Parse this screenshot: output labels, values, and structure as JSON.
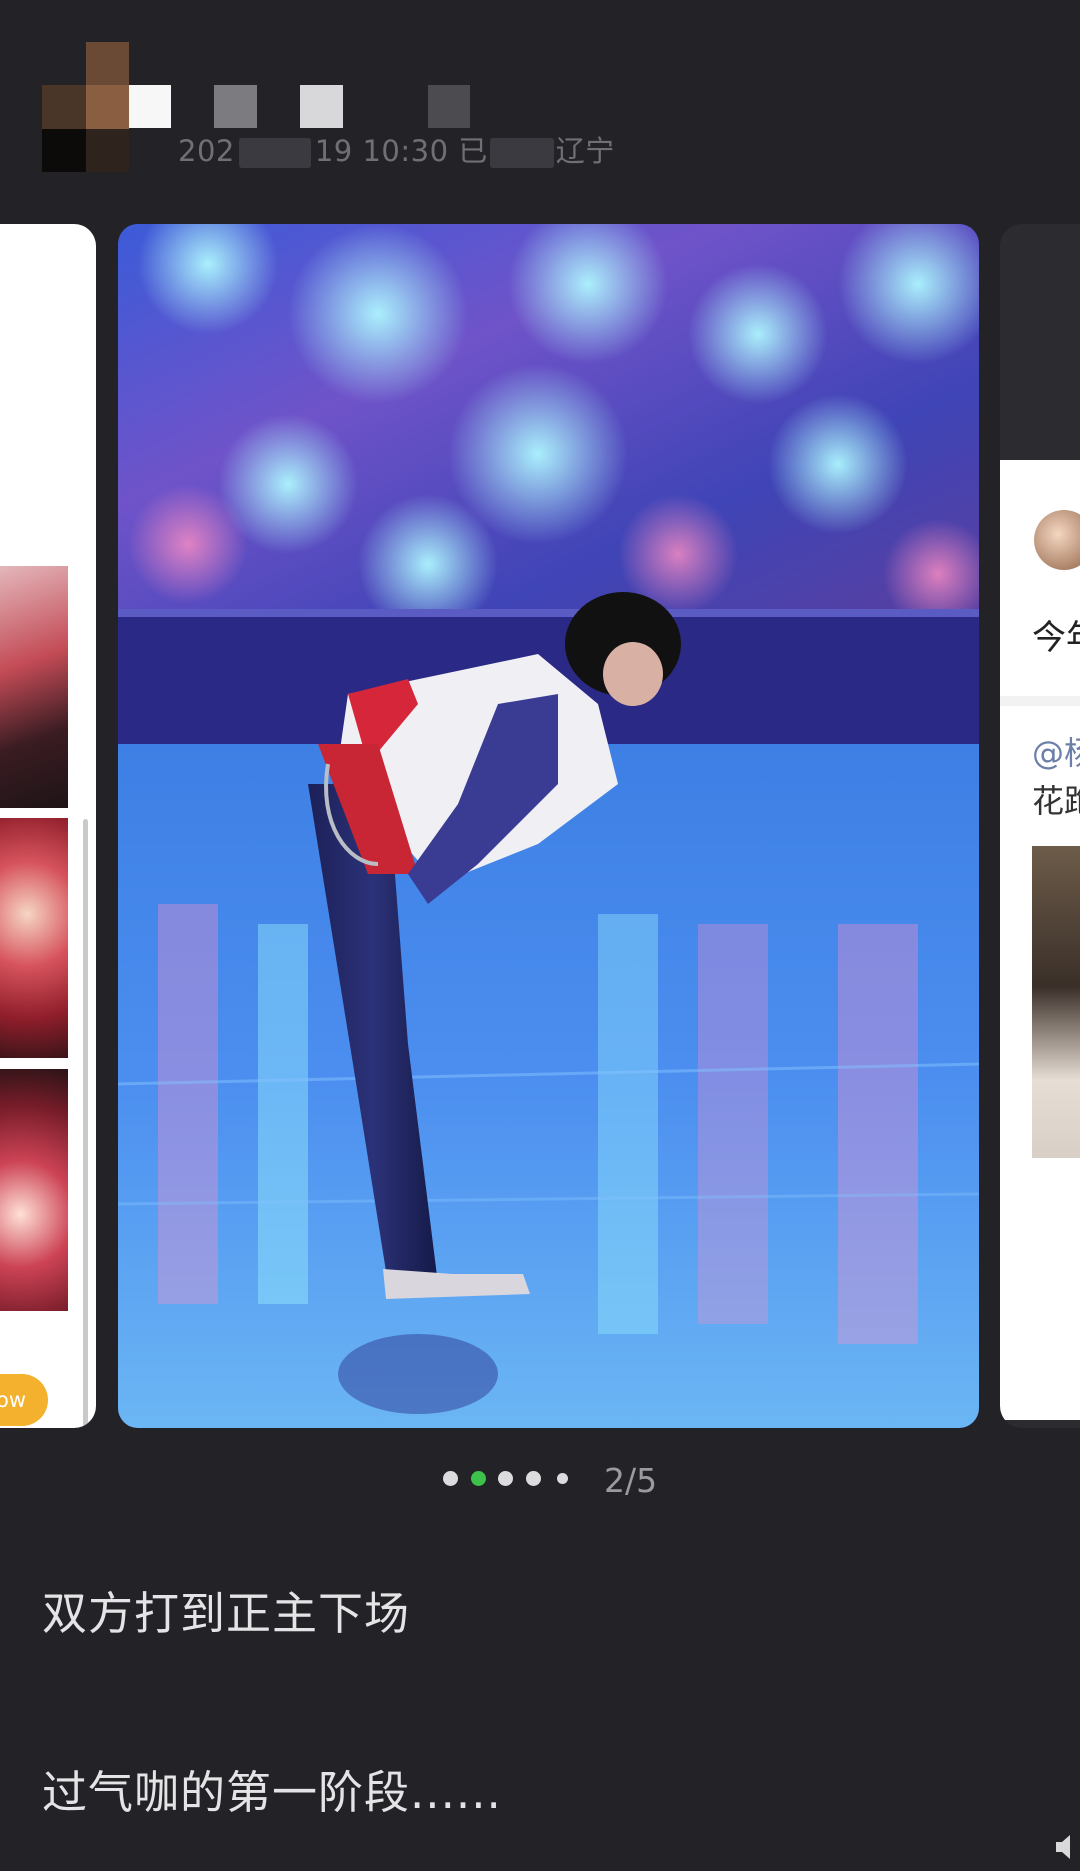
{
  "post": {
    "meta_partial": "202",
    "time_partial": "19 10:30",
    "via_partial": "已",
    "location": "辽宁"
  },
  "carousel": {
    "current_page": 2,
    "total_pages": 5,
    "counter": "2/5",
    "right_card": {
      "line1": "今年",
      "line2": "@杨",
      "line3": "花跑"
    },
    "left_card": {
      "pill": "ow"
    }
  },
  "caption": {
    "line1": "双方打到正主下场",
    "line2": "过气咖的第一阶段......"
  },
  "colors": {
    "background": "#232327",
    "active_dot": "#3cc24a",
    "pill": "#f4b12e"
  }
}
